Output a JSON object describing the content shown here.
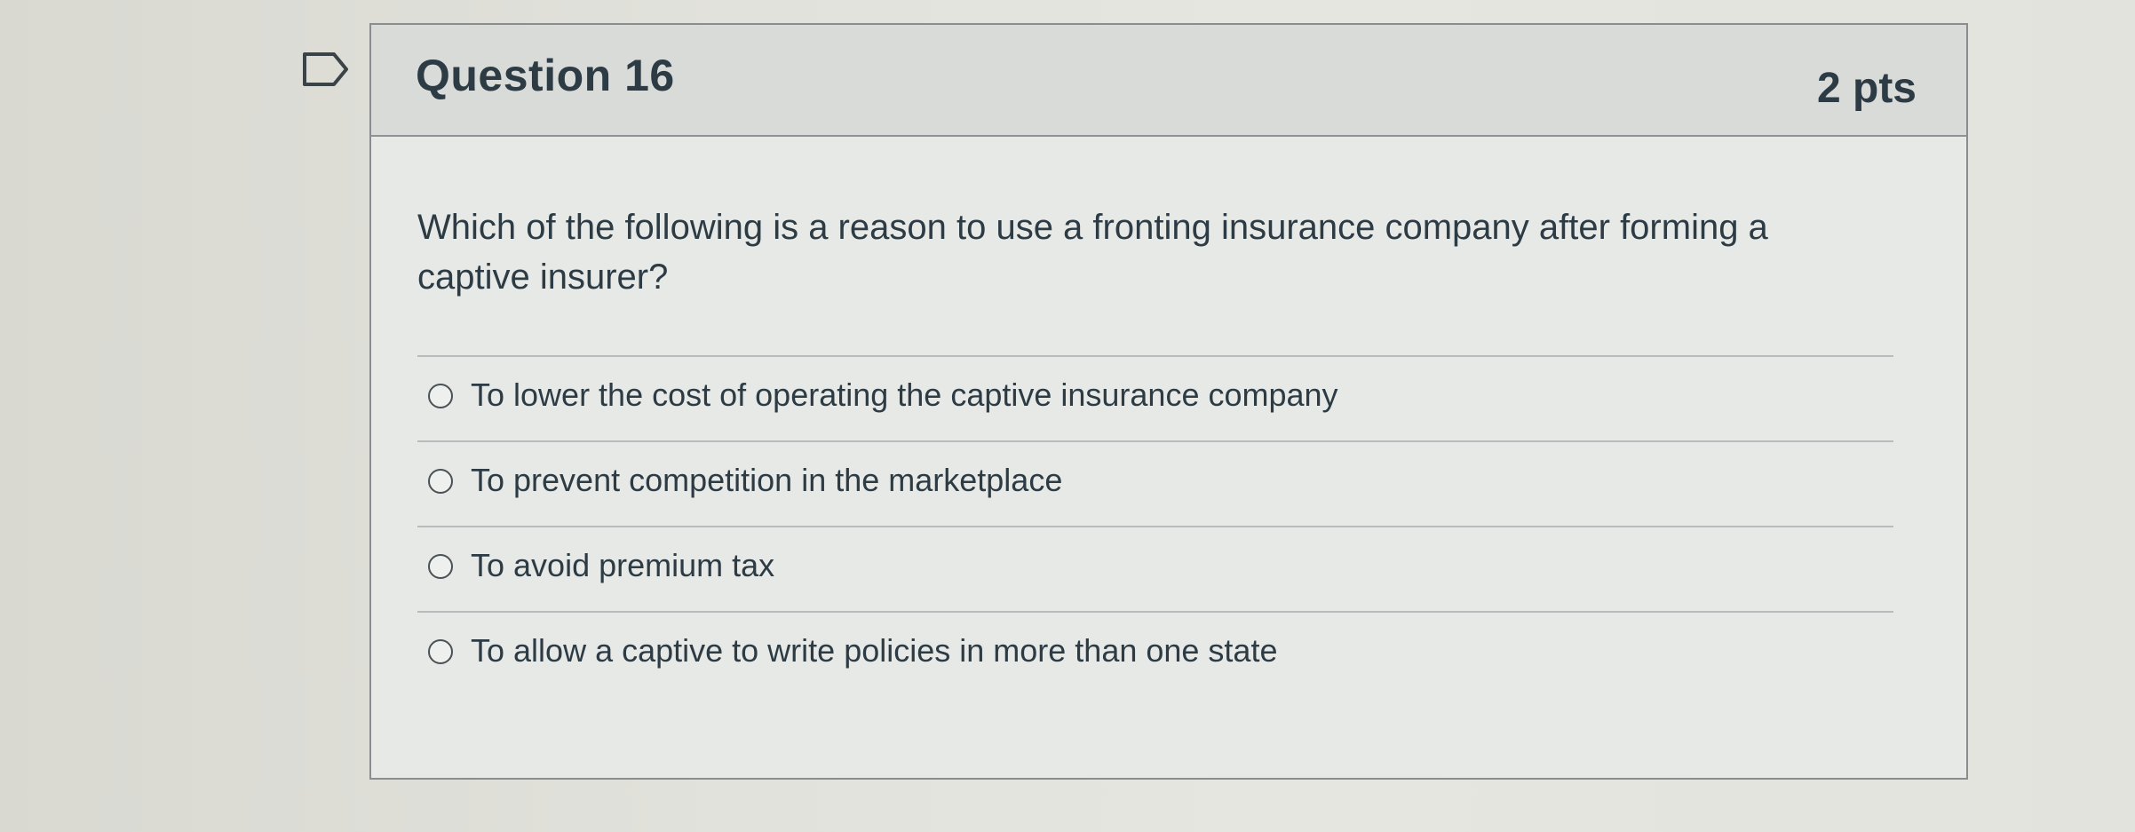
{
  "question": {
    "title": "Question 16",
    "points": "2 pts",
    "text": "Which of the following is a reason to use a fronting insurance company after forming a captive insurer?",
    "flag_icon": "flag-icon"
  },
  "answers": [
    {
      "label": "To lower the cost of operating the captive insurance company",
      "selected": false
    },
    {
      "label": "To prevent competition in the marketplace",
      "selected": false
    },
    {
      "label": "To avoid premium tax",
      "selected": false
    },
    {
      "label": "To allow a captive to write policies in more than one state",
      "selected": false
    }
  ],
  "colors": {
    "text": "#2d3b45",
    "header_bg": "#d9dbd9",
    "card_bg": "#e7e9e6",
    "border": "#8a8d90"
  }
}
